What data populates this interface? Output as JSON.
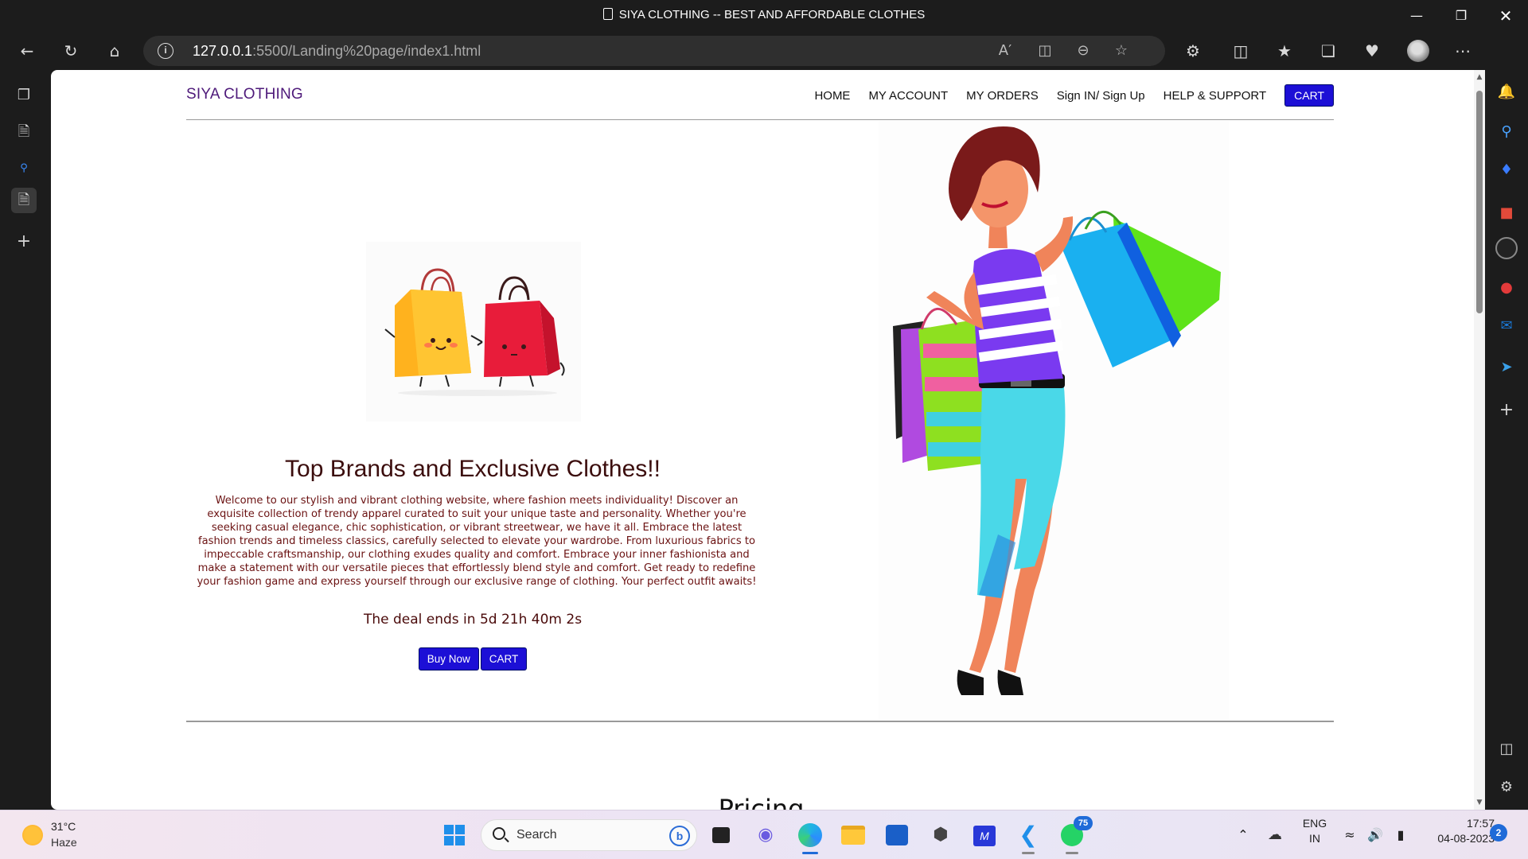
{
  "window": {
    "title": "SIYA CLOTHING -- BEST AND AFFORDABLE CLOTHES",
    "minimize_icon": "minimize-icon",
    "maximize_icon": "restore-icon",
    "close_icon": "close-icon"
  },
  "browser": {
    "url_host": "127.0.0.1",
    "url_rest": ":5500/Landing%20page/index1.html",
    "toolbar_icons": [
      "back-icon",
      "refresh-icon",
      "home-icon"
    ],
    "url_actions": [
      "read-aloud-icon",
      "immersive-reader-icon",
      "zoom-out-icon",
      "favorite-star-icon"
    ],
    "right_actions": [
      "extensions-icon",
      "split-screen-icon",
      "favorites-icon",
      "collections-icon",
      "browser-essentials-icon",
      "profile-avatar",
      "more-options-icon",
      "bing-copilot-icon"
    ]
  },
  "site": {
    "brand": "SIYA CLOTHING",
    "nav": [
      {
        "label": "HOME"
      },
      {
        "label": "MY ACCOUNT"
      },
      {
        "label": "MY ORDERS"
      },
      {
        "label": "Sign IN/ Sign Up"
      },
      {
        "label": "HELP & SUPPORT"
      }
    ],
    "nav_cart": "CART",
    "hero": {
      "title": "Top Brands and Exclusive Clothes!!",
      "body": "Welcome to our stylish and vibrant clothing website, where fashion meets individuality! Discover an exquisite collection of trendy apparel curated to suit your unique taste and personality. Whether you're seeking casual elegance, chic sophistication, or vibrant streetwear, we have it all. Embrace the latest fashion trends and timeless classics, carefully selected to elevate your wardrobe. From luxurious fabrics to impeccable craftsmanship, our clothing exudes quality and comfort. Embrace your inner fashionista and make a statement with our versatile pieces that effortlessly blend style and comfort. Get ready to redefine your fashion game and express yourself through our exclusive range of clothing. Your perfect outfit awaits!",
      "deal": "The deal ends in 5d 21h 40m 2s",
      "buy_now": "Buy Now",
      "cart": "CART"
    },
    "next_section_peek": "Pricing"
  },
  "taskbar": {
    "weather_temp": "31°C",
    "weather_cond": "Haze",
    "search_label": "Search",
    "whatsapp_badge": "75",
    "lang_top": "ENG",
    "lang_bottom": "IN",
    "time": "17:57",
    "date": "04-08-2023",
    "notification_count": "2"
  },
  "colors": {
    "brand_purple": "#4e1a7a",
    "button_blue": "#1c0fd6",
    "hero_text_maroon": "#6b1212"
  }
}
